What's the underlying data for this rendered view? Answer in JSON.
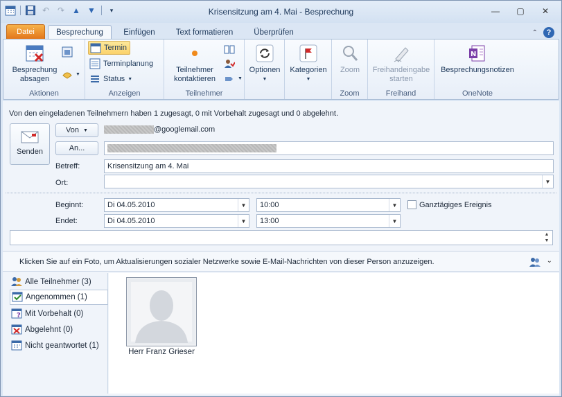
{
  "window": {
    "title": "Krisensitzung am 4. Mai  -  Besprechung"
  },
  "tabs": {
    "file": "Datei",
    "items": [
      "Besprechung",
      "Einfügen",
      "Text formatieren",
      "Überprüfen"
    ]
  },
  "ribbon": {
    "aktionen": {
      "label": "Aktionen",
      "cancel": "Besprechung\nabsagen"
    },
    "anzeigen": {
      "label": "Anzeigen",
      "termin": "Termin",
      "terminplanung": "Terminplanung",
      "status": "Status"
    },
    "teilnehmer": {
      "label": "Teilnehmer",
      "contact": "Teilnehmer\nkontaktieren"
    },
    "optionen": {
      "label": "Optionen"
    },
    "kategorien": {
      "label": "Kategorien"
    },
    "zoom": {
      "label": "Zoom",
      "button": "Zoom"
    },
    "freihand": {
      "label": "Freihand",
      "button": "Freihandeingabe\nstarten"
    },
    "onenote": {
      "label": "OneNote",
      "button": "Besprechungsnotizen"
    }
  },
  "form": {
    "info": "Von den eingeladenen Teilnehmern haben 1 zugesagt, 0 mit Vorbehalt zugesagt und 0 abgelehnt.",
    "send": "Senden",
    "from_button": "Von",
    "from_value": "@googlemail.com",
    "to_button": "An...",
    "subject_label": "Betreff:",
    "subject_value": "Krisensitzung am 4. Mai",
    "location_label": "Ort:",
    "location_value": "",
    "start_label": "Beginnt:",
    "start_date": "Di 04.05.2010",
    "start_time": "10:00",
    "end_label": "Endet:",
    "end_date": "Di 04.05.2010",
    "end_time": "13:00",
    "allday_label": "Ganztägiges Ereignis",
    "allday_checked": false
  },
  "social": {
    "hint": "Klicken Sie auf ein Foto, um Aktualisierungen sozialer Netzwerke sowie E-Mail-Nachrichten von dieser Person anzuzeigen.",
    "filters": [
      {
        "label": "Alle Teilnehmer (3)"
      },
      {
        "label": "Angenommen (1)"
      },
      {
        "label": "Mit Vorbehalt (0)"
      },
      {
        "label": "Abgelehnt (0)"
      },
      {
        "label": "Nicht geantwortet (1)"
      }
    ],
    "people": [
      {
        "name": "Herr Franz Grieser"
      }
    ]
  }
}
